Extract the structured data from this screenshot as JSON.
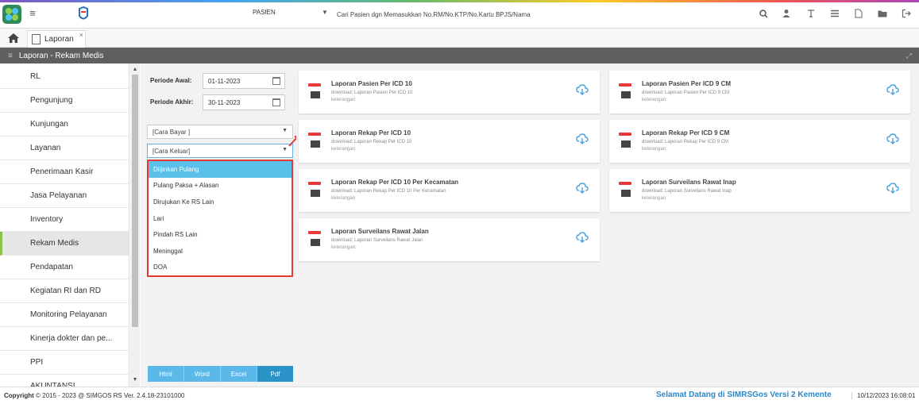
{
  "header": {
    "patient_select": "PASIEN",
    "search_placeholder": "Cari Pasien dgn Memasukkan No.RM/No.KTP/No.Kartu BPJS/Nama"
  },
  "tabs": {
    "active_tab": "Laporan"
  },
  "section": {
    "title": "Laporan - Rekam Medis"
  },
  "sidebar": {
    "items": [
      "RL",
      "Pengunjung",
      "Kunjungan",
      "Layanan",
      "Penerimaan Kasir",
      "Jasa Pelayanan",
      "Inventory",
      "Rekam Medis",
      "Pendapatan",
      "Kegiatan RI dan RD",
      "Monitoring Pelayanan",
      "Kinerja dokter dan pe...",
      "PPI",
      "AKUNTANSI"
    ],
    "active_index": 7
  },
  "filter": {
    "periode_awal_label": "Periode Awal:",
    "periode_awal_value": "01-11-2023",
    "periode_akhir_label": "Periode Akhir:",
    "periode_akhir_value": "30-11-2023",
    "cara_bayar": "[Cara Bayar ]",
    "cara_keluar": "[Cara Keluar]",
    "options": [
      "Diijinkan Pulang",
      "Pulang Paksa + Alasan",
      "Dirujukan Ke RS Lain",
      "Lari",
      "Pindah RS Lain",
      "Meninggal",
      "DOA"
    ],
    "selected_option_index": 0,
    "buttons": [
      "Html",
      "Word",
      "Excel",
      "Pdf"
    ]
  },
  "reports": {
    "items": [
      {
        "title": "Laporan Pasien Per ICD 10",
        "desc": "download: Laporan Pasien Per ICD 10",
        "note": "keterangan:"
      },
      {
        "title": "Laporan Pasien Per ICD 9 CM",
        "desc": "download: Laporan Pasien Per ICD 9 CM",
        "note": "keterangan:"
      },
      {
        "title": "Laporan Rekap Per ICD 10",
        "desc": "download: Laporan Rekap Per ICD 10",
        "note": "keterangan:"
      },
      {
        "title": "Laporan Rekap Per ICD 9 CM",
        "desc": "download: Laporan Rekap Per ICD 9 CM",
        "note": "keterangan:"
      },
      {
        "title": "Laporan Rekap Per ICD 10 Per Kecamatan",
        "desc": "download: Laporan Rekap Per ICD 10 Per Kecamatan",
        "note": "keterangan:"
      },
      {
        "title": "Laporan Surveilans Rawat Inap",
        "desc": "download: Laporan Surveilans Rawat Inap",
        "note": "keterangan:"
      },
      {
        "title": "Laporan Surveilans Rawat Jalan",
        "desc": "download: Laporan Surveilans Rawat Jalan",
        "note": "keterangan:"
      }
    ]
  },
  "footer": {
    "copyright_prefix": "Copyright",
    "copyright_text": "2015 - 2023 @ SIMGOS RS Ver. 2.4.18-23101000",
    "welcome": "Selamat Datang di SIMRSGos Versi 2 Kemente",
    "datetime": "10/12/2023 16:08:01"
  },
  "colors": {
    "accent": "#5bc0ea",
    "highlight_border": "#e53935",
    "section_bar": "#5f5f5f",
    "welcome_text": "#2b87c7"
  },
  "icons": [
    "app-logo-icon",
    "menu-icon",
    "brand-icon",
    "caret-down-icon",
    "search-icon",
    "user-icon",
    "text-icon",
    "list-icon",
    "document-icon",
    "folder-icon",
    "logout-icon",
    "home-icon",
    "document-tab-icon",
    "close-icon",
    "expand-icon",
    "calendar-icon",
    "download-icon",
    "report-icon"
  ]
}
